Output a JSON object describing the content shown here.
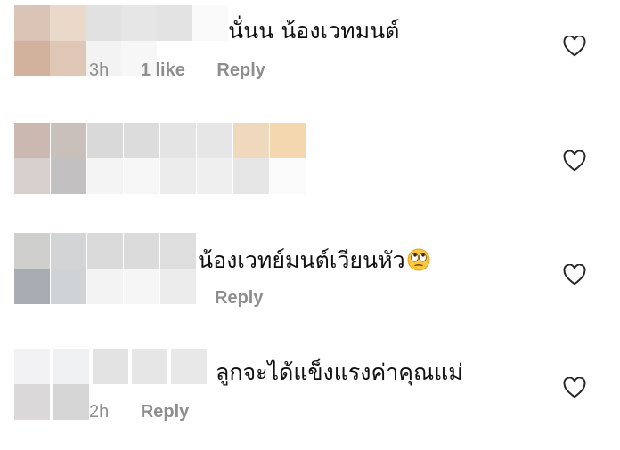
{
  "comments": [
    {
      "text": "นั่นน น้องเวทมนต์",
      "time": "3h",
      "likes": "1 like",
      "reply": "Reply",
      "emoji": ""
    },
    {
      "text": "",
      "time": "",
      "likes": "",
      "reply": "",
      "emoji": ""
    },
    {
      "text": "น้องเวทย์มนต์เวียนหัว",
      "time": "",
      "likes": "",
      "reply": "Reply",
      "emoji": "face-with-rolling-eyes"
    },
    {
      "text": "ลูกจะได้แข็งแรงค่าคุณแม่",
      "time": "2h",
      "likes": "",
      "reply": "Reply",
      "emoji": ""
    }
  ],
  "icons": {
    "like": "heart-outline-icon"
  },
  "colors": {
    "meta_text": "#8e8e8e",
    "heart_stroke": "#262626",
    "text": "#111111"
  }
}
